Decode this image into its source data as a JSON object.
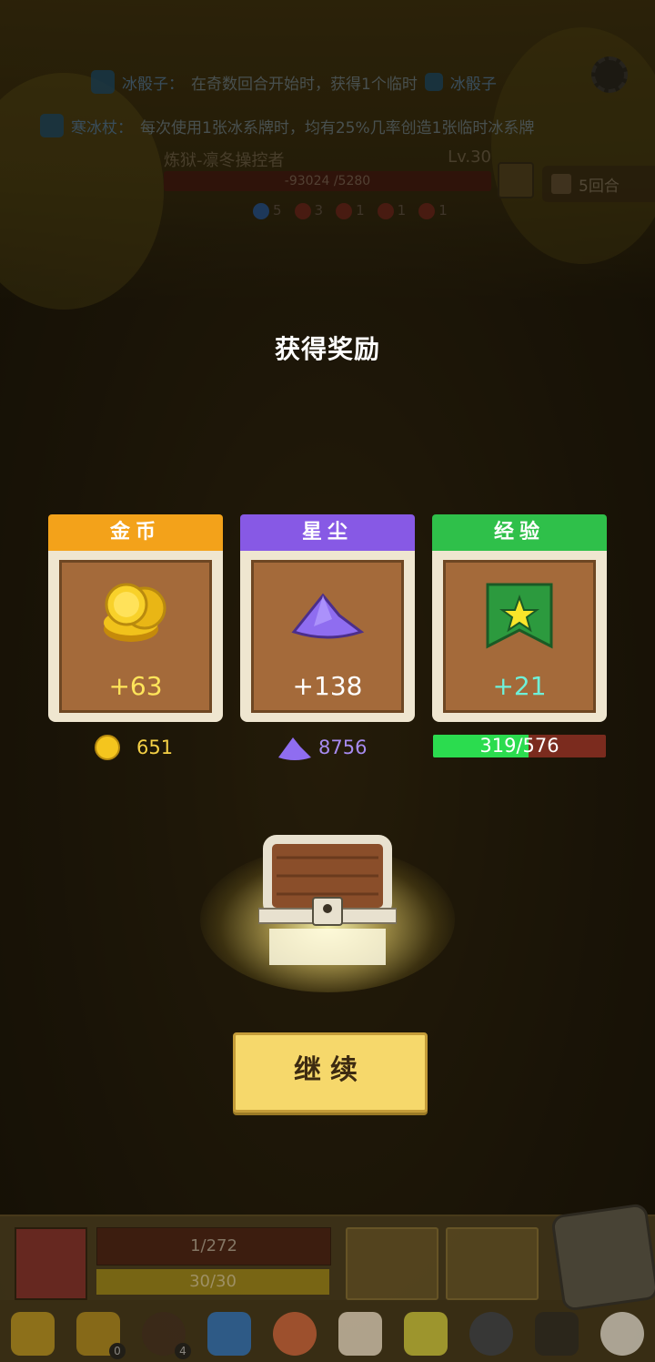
{
  "buffs": [
    {
      "name": "冰骰子：",
      "text": "在奇数回合开始时，获得1个临时",
      "tail": "冰骰子"
    },
    {
      "name": "寒冰杖：",
      "text": "每次使用1张冰系牌时，均有25%几率创造1张临时冰系牌"
    }
  ],
  "enemy": {
    "name": "炼狱-凛冬操控者",
    "level": "Lv.30",
    "hp_text": "-93024 /5280"
  },
  "statuses": [
    "5",
    "3",
    "1",
    "1",
    "1"
  ],
  "turns_label": "5回合",
  "reward": {
    "title": "获得奖励",
    "cards": [
      {
        "label": "金币",
        "amount": "+63",
        "total": "651",
        "color": "#f3a21a",
        "amount_color": "#ffe55a"
      },
      {
        "label": "星尘",
        "amount": "+138",
        "total": "8756",
        "color": "#8759e5",
        "amount_color": "#ffffff"
      },
      {
        "label": "经验",
        "amount": "+21",
        "total": "319/576",
        "color": "#2fc04a",
        "amount_color": "#6ef0d8"
      }
    ],
    "xp_fraction": 0.554
  },
  "continue_label": "继续",
  "hud": {
    "hp_text": "1/272",
    "shield_text": "30/30",
    "badges": [
      "0",
      "4"
    ]
  }
}
